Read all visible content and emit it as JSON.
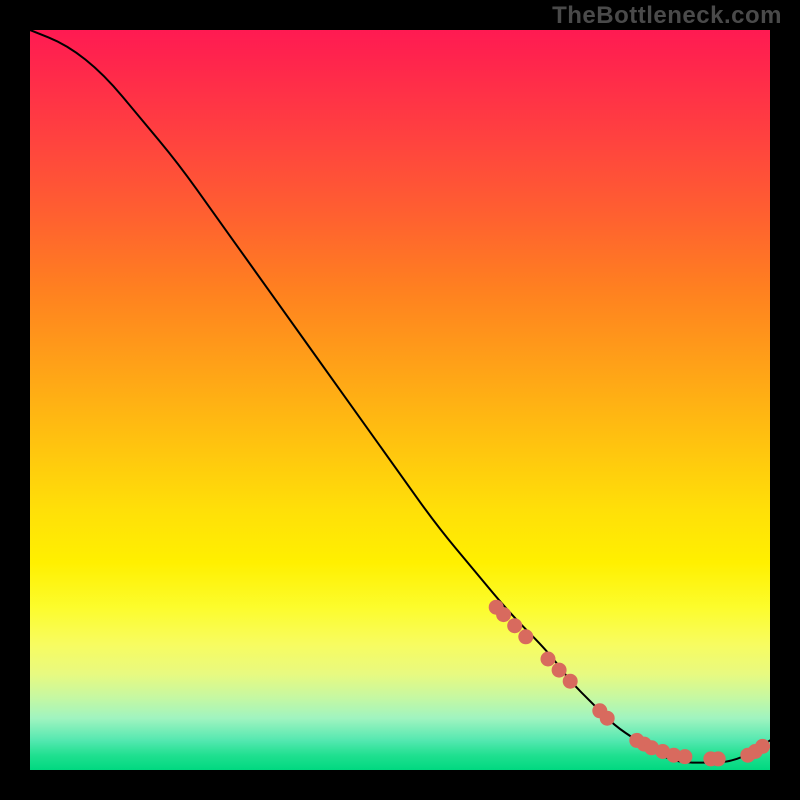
{
  "watermark": "TheBottleneck.com",
  "chart_data": {
    "type": "line",
    "title": "",
    "xlabel": "",
    "ylabel": "",
    "xlim": [
      0,
      100
    ],
    "ylim": [
      0,
      100
    ],
    "series": [
      {
        "name": "bottleneck-curve",
        "x": [
          0,
          5,
          10,
          15,
          20,
          25,
          30,
          35,
          40,
          45,
          50,
          55,
          60,
          65,
          70,
          73,
          76,
          79,
          82,
          85,
          88,
          91,
          94,
          97,
          100
        ],
        "y": [
          100,
          98,
          94,
          88,
          82,
          75,
          68,
          61,
          54,
          47,
          40,
          33,
          27,
          21,
          16,
          12,
          9,
          6,
          4,
          2,
          1,
          1,
          1,
          2,
          4
        ]
      }
    ],
    "markers": {
      "name": "highlight-points",
      "color": "#d86a5e",
      "x": [
        63,
        64,
        65.5,
        67,
        70,
        71.5,
        73,
        77,
        78,
        82,
        83,
        84,
        85.5,
        87,
        88.5,
        92,
        93,
        97,
        98,
        99
      ],
      "y": [
        22,
        21,
        19.5,
        18,
        15,
        13.5,
        12,
        8,
        7,
        4,
        3.5,
        3,
        2.5,
        2,
        1.8,
        1.5,
        1.5,
        2,
        2.5,
        3.2
      ]
    }
  }
}
